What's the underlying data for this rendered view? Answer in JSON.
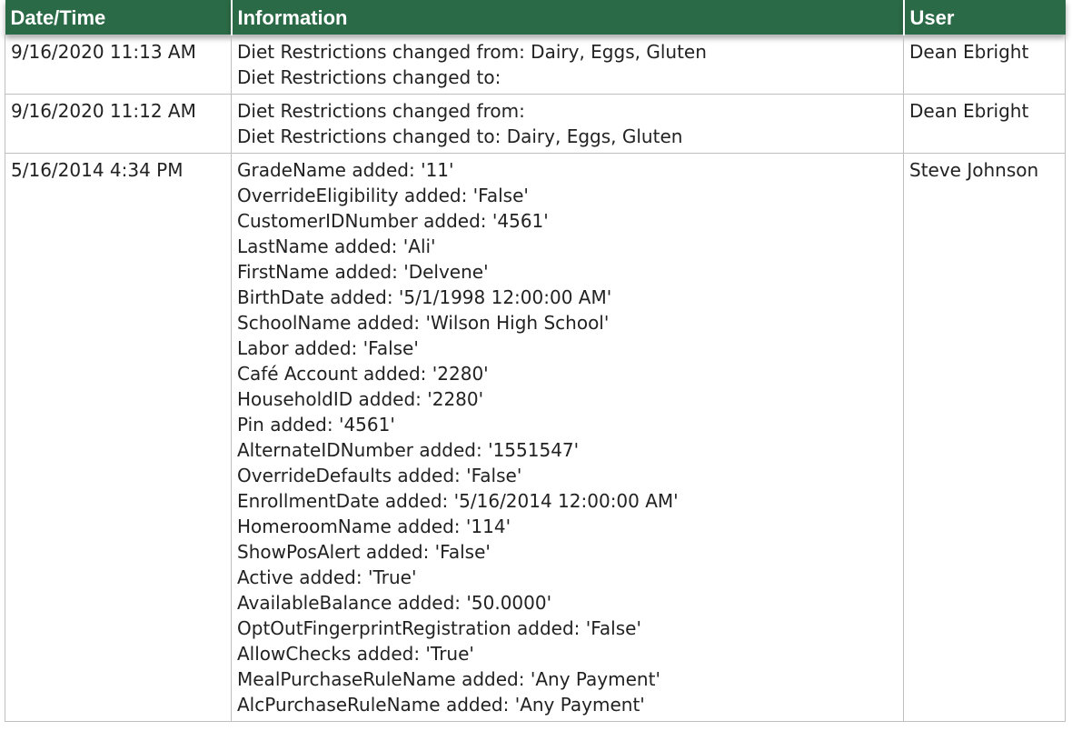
{
  "table": {
    "headers": {
      "datetime": "Date/Time",
      "information": "Information",
      "user": "User"
    },
    "rows": [
      {
        "datetime": "9/16/2020 11:13 AM",
        "lines": [
          "Diet Restrictions changed from: Dairy, Eggs, Gluten",
          "Diet Restrictions changed to:"
        ],
        "user": "Dean Ebright"
      },
      {
        "datetime": "9/16/2020 11:12 AM",
        "lines": [
          "Diet Restrictions changed from:",
          "Diet Restrictions changed to: Dairy, Eggs, Gluten"
        ],
        "user": "Dean Ebright"
      },
      {
        "datetime": "5/16/2014 4:34 PM",
        "lines": [
          "GradeName added: '11'",
          "OverrideEligibility added: 'False'",
          "CustomerIDNumber added: '4561'",
          "LastName added: 'Ali'",
          "FirstName added: 'Delvene'",
          "BirthDate added: '5/1/1998 12:00:00 AM'",
          "SchoolName added: 'Wilson High School'",
          "Labor added: 'False'",
          "Café Account added: '2280'",
          "HouseholdID added: '2280'",
          "Pin added: '4561'",
          "AlternateIDNumber added: '1551547'",
          "OverrideDefaults added: 'False'",
          "EnrollmentDate added: '5/16/2014 12:00:00 AM'",
          "HomeroomName added: '114'",
          "ShowPosAlert added: 'False'",
          "Active added: 'True'",
          "AvailableBalance added: '50.0000'",
          "OptOutFingerprintRegistration added: 'False'",
          "AllowChecks added: 'True'",
          "MealPurchaseRuleName added: 'Any Payment'",
          "AlcPurchaseRuleName added: 'Any Payment'"
        ],
        "user": "Steve Johnson"
      }
    ]
  },
  "colors": {
    "header_bg": "#2b6a46",
    "header_text": "#ffffff",
    "border": "#bfbfbf"
  }
}
